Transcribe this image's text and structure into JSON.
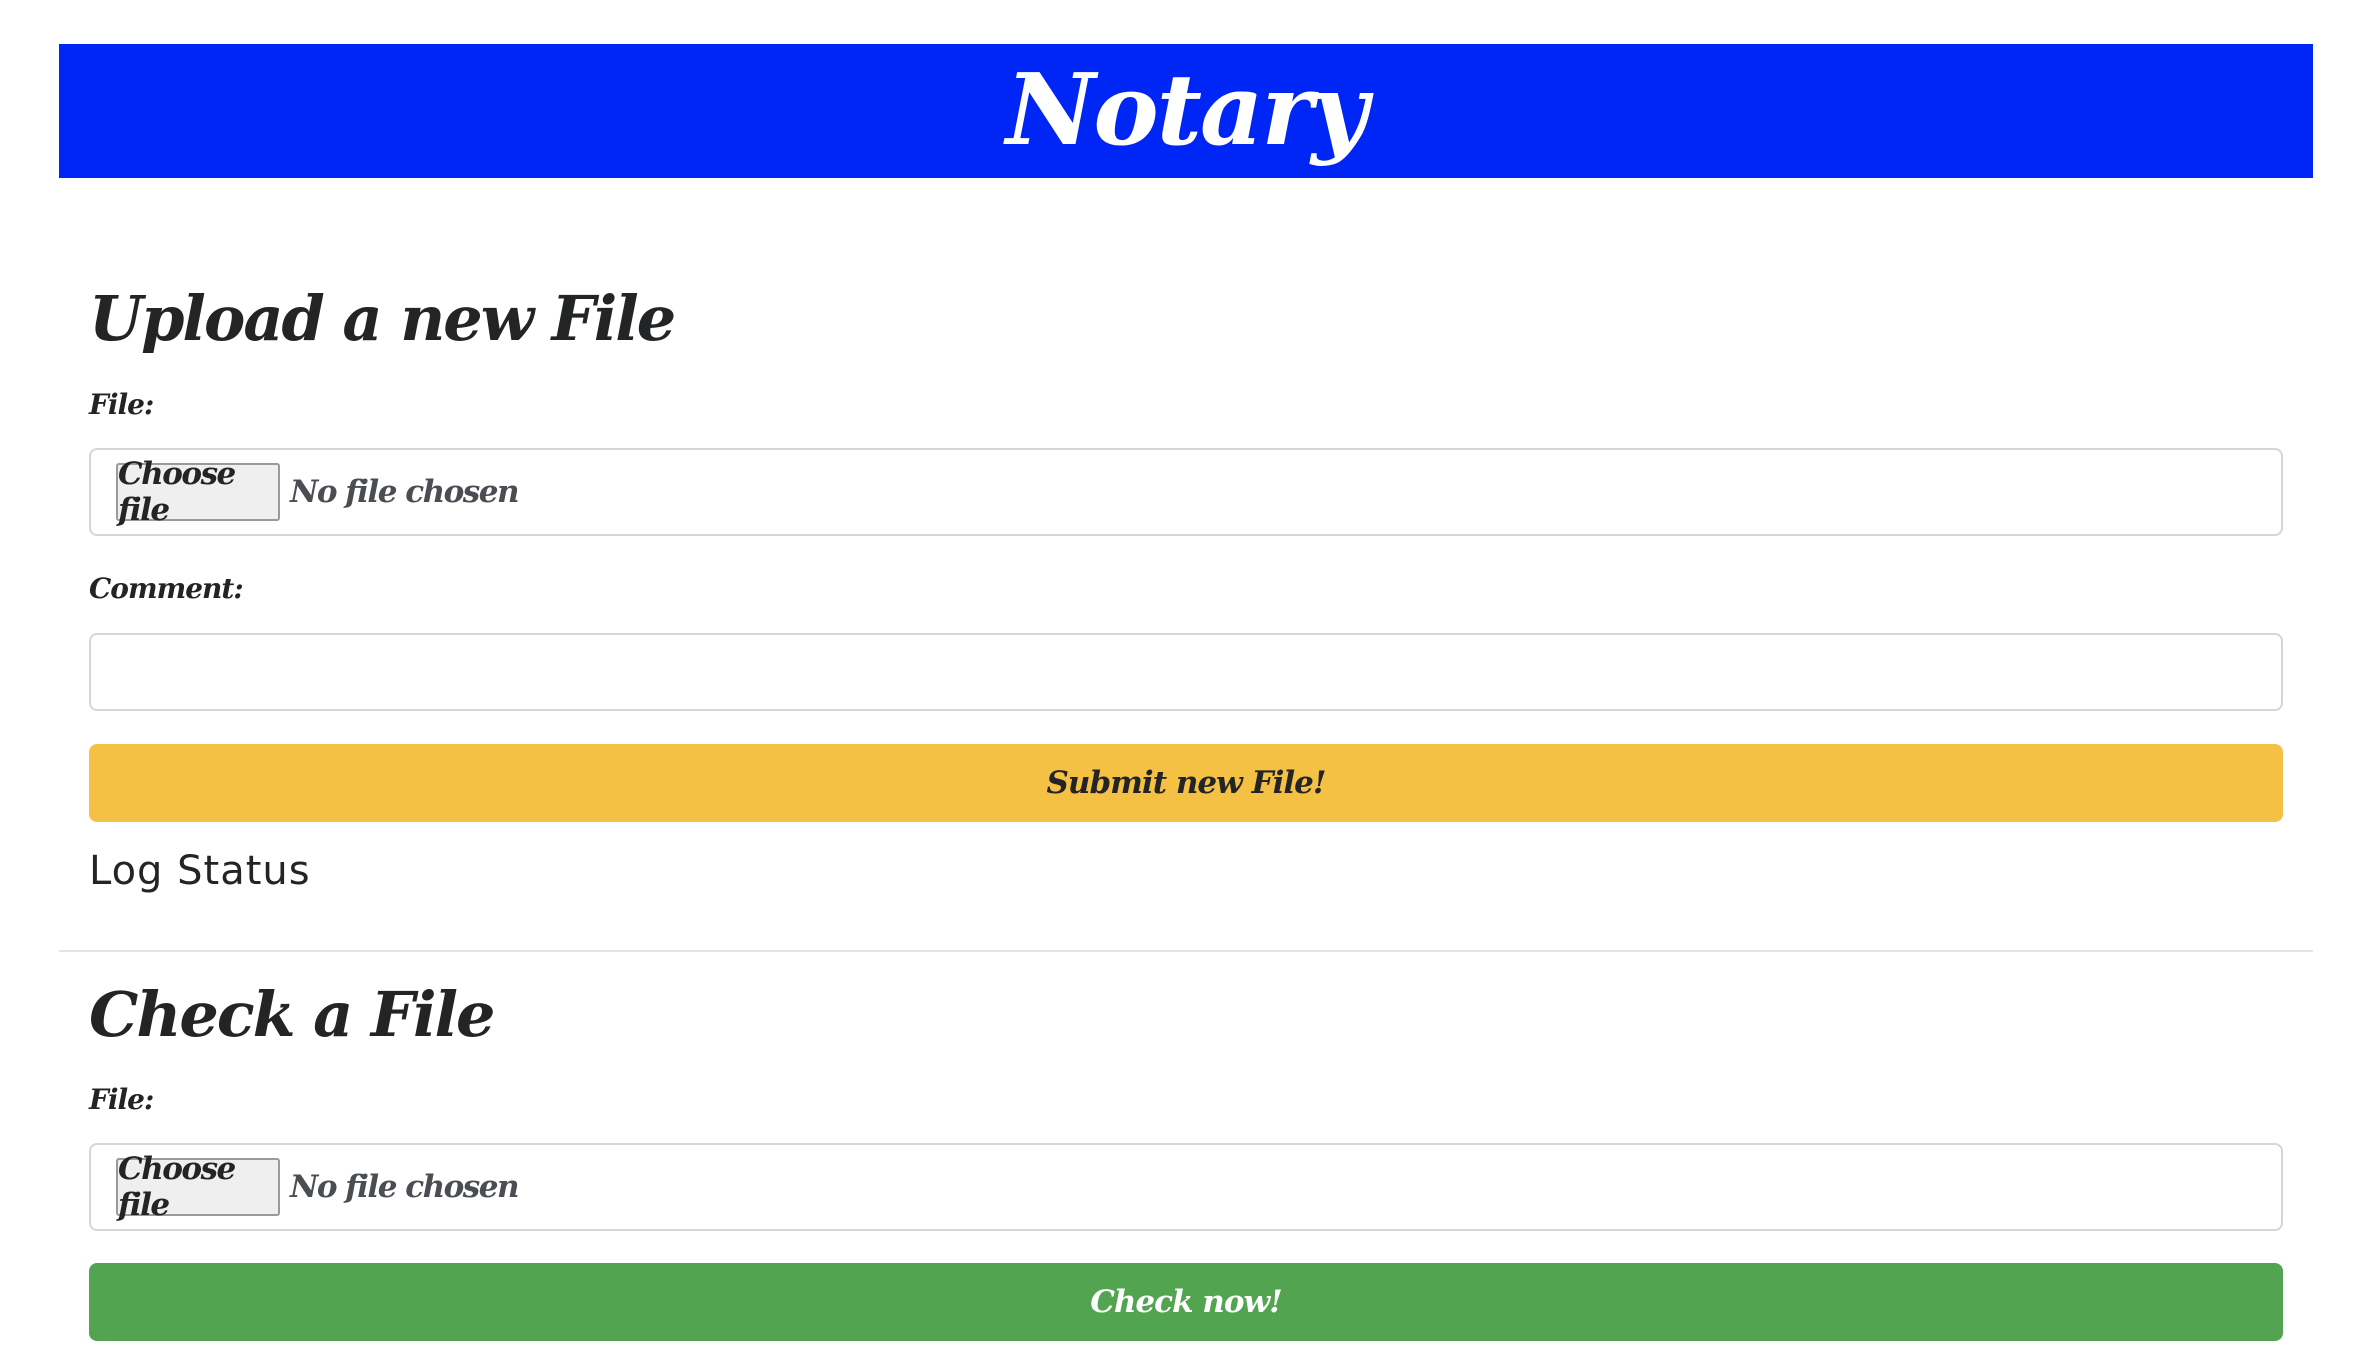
{
  "header": {
    "title": "Notary"
  },
  "upload": {
    "heading": "Upload a new File",
    "file_label": "File:",
    "choose_label": "Choose file",
    "no_file_text": "No file chosen",
    "comment_label": "Comment:",
    "comment_value": "",
    "submit_label": "Submit new File!",
    "log_status": "Log Status"
  },
  "check": {
    "heading": "Check a File",
    "file_label": "File:",
    "choose_label": "Choose file",
    "no_file_text": "No file chosen",
    "check_label": "Check now!"
  },
  "colors": {
    "header_bg": "#0026f5",
    "submit_bg": "#f4c145",
    "check_bg": "#53a450"
  }
}
